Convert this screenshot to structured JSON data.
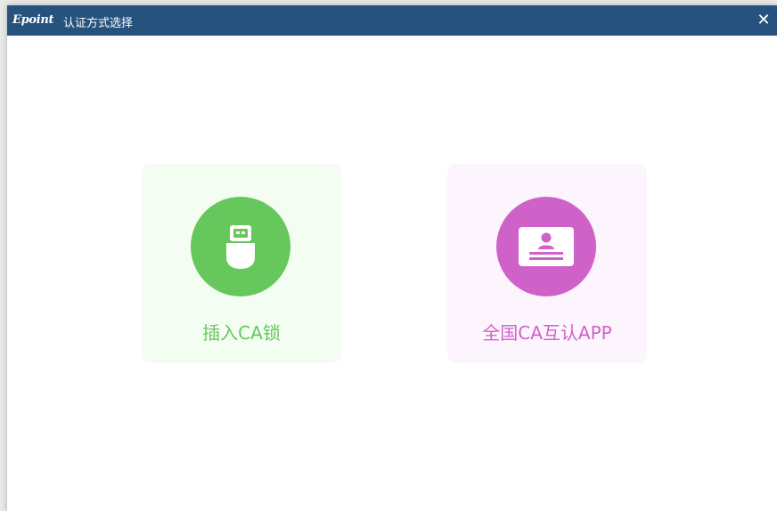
{
  "window": {
    "logo": "Epoint",
    "title": "认证方式选择",
    "close_glyph": "✕"
  },
  "options": [
    {
      "label": "插入CA锁",
      "icon": "usb-key-icon",
      "color": "#66c75c",
      "bg": "#f4fdf2"
    },
    {
      "label": "全国CA互认APP",
      "icon": "id-card-icon",
      "color": "#cf62c8",
      "bg": "#fdf5fd"
    }
  ],
  "colors": {
    "titlebar": "#27527e",
    "usb_green": "#66c75c",
    "app_purple": "#cf62c8"
  }
}
